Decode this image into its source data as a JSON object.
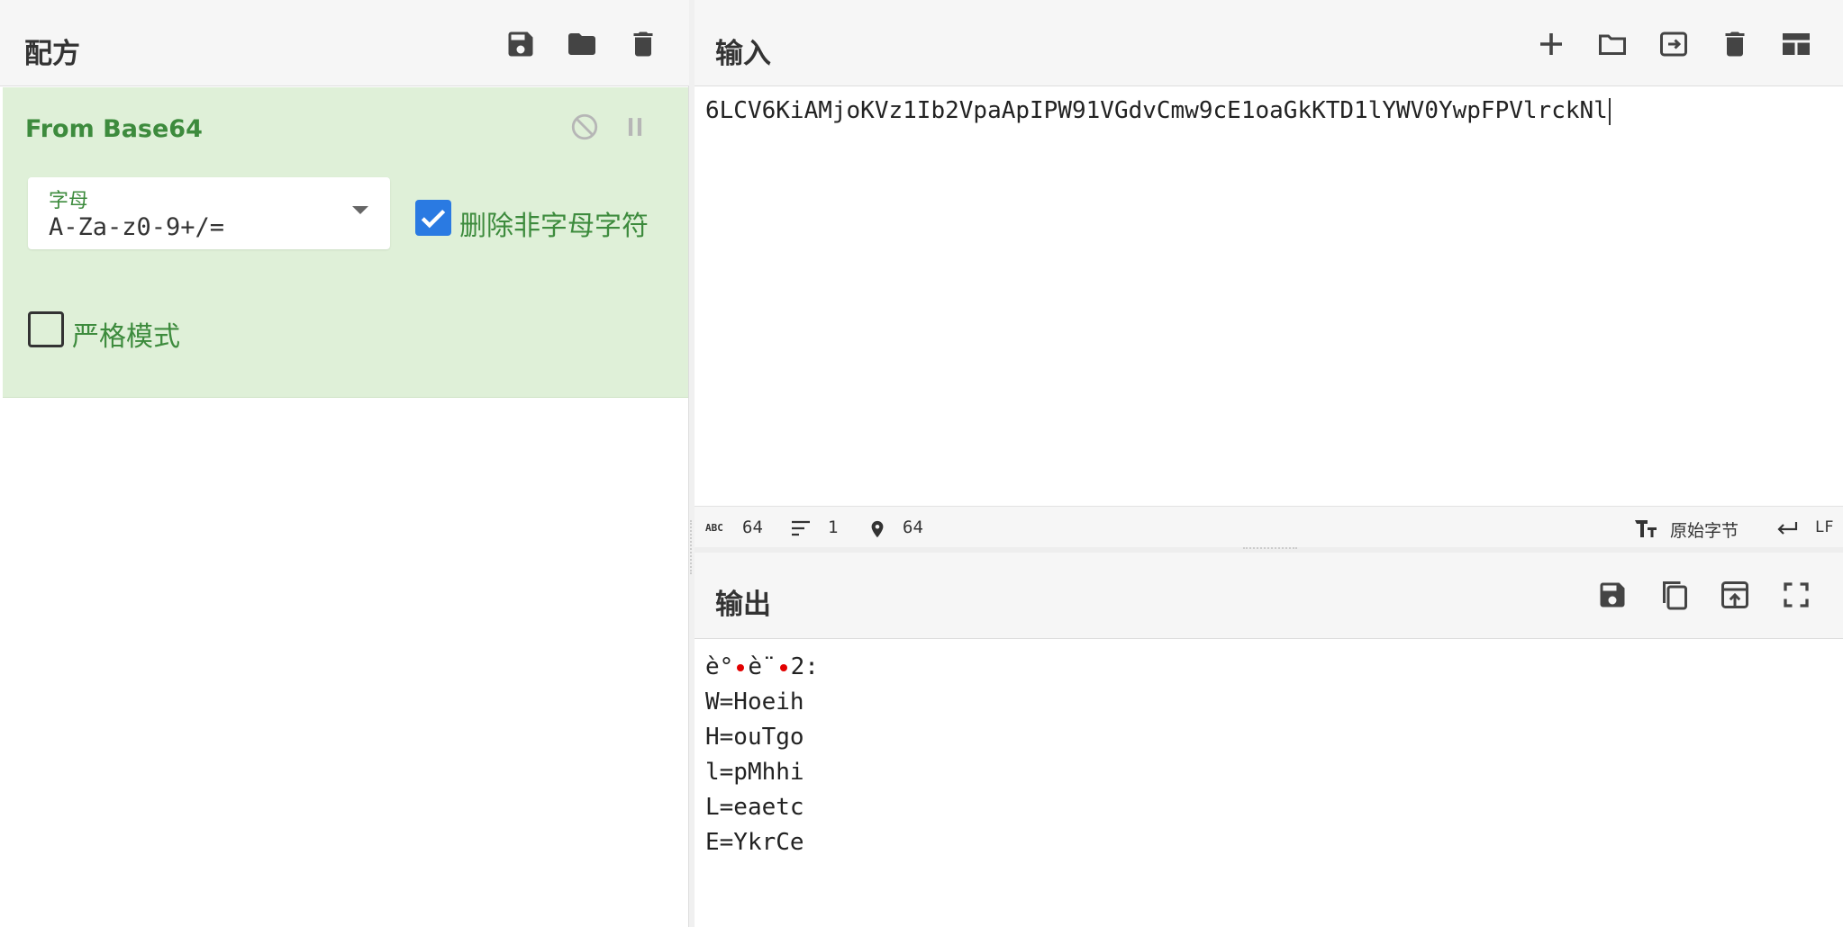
{
  "recipe": {
    "title": "配方",
    "operation": {
      "name": "From Base64",
      "alphabet_label": "字母",
      "alphabet_value": "A-Za-z0-9+/=",
      "remove_non_alpha_label": "删除非字母字符",
      "remove_non_alpha_checked": true,
      "strict_mode_label": "严格模式",
      "strict_mode_checked": false
    }
  },
  "input": {
    "title": "输入",
    "text": "6LCV6KiAMjoKVz1Ib2VpaApIPW91VGdvCmw9cE1oaGkKTD1lYWV0YwpFPVlrckNl",
    "status": {
      "length": "64",
      "lines": "1",
      "position": "64",
      "encoding": "原始字节",
      "eol": "LF"
    }
  },
  "output": {
    "title": "输出",
    "first_line_parts": [
      "è°",
      "è¨",
      "2:"
    ],
    "lines": [
      "W=Hoeih",
      "H=ouTgo",
      "l=pMhhi",
      "L=eaetc",
      "E=YkrCe"
    ]
  },
  "colors": {
    "accent_green": "#3d8b3d",
    "op_background": "#dff0d8",
    "checkbox_blue": "#2a7ae2",
    "control_char_red": "#e20000"
  }
}
